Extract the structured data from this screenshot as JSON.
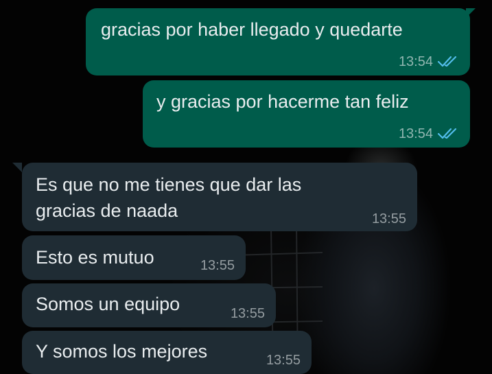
{
  "conversation": {
    "messages": [
      {
        "direction": "outgoing",
        "text": "gracias por haber llegado y quedarte",
        "time": "13:54",
        "status_icon": "double-check-read-icon"
      },
      {
        "direction": "outgoing",
        "text": "y gracias por hacerme tan feliz",
        "time": "13:54",
        "status_icon": "double-check-read-icon"
      },
      {
        "direction": "incoming",
        "text_lines": [
          "Es que no me tienes que dar las",
          "gracias de naada"
        ],
        "time": "13:55"
      },
      {
        "direction": "incoming",
        "text": "Esto es mutuo",
        "time": "13:55"
      },
      {
        "direction": "incoming",
        "text": "Somos un equipo",
        "time": "13:55"
      },
      {
        "direction": "incoming",
        "text": "Y somos los mejores",
        "time": "13:55"
      }
    ]
  },
  "colors": {
    "outgoing_bubble": "#005c4b",
    "incoming_bubble": "#1f2c34",
    "read_tick": "#53bdeb",
    "text": "#e9edef"
  }
}
